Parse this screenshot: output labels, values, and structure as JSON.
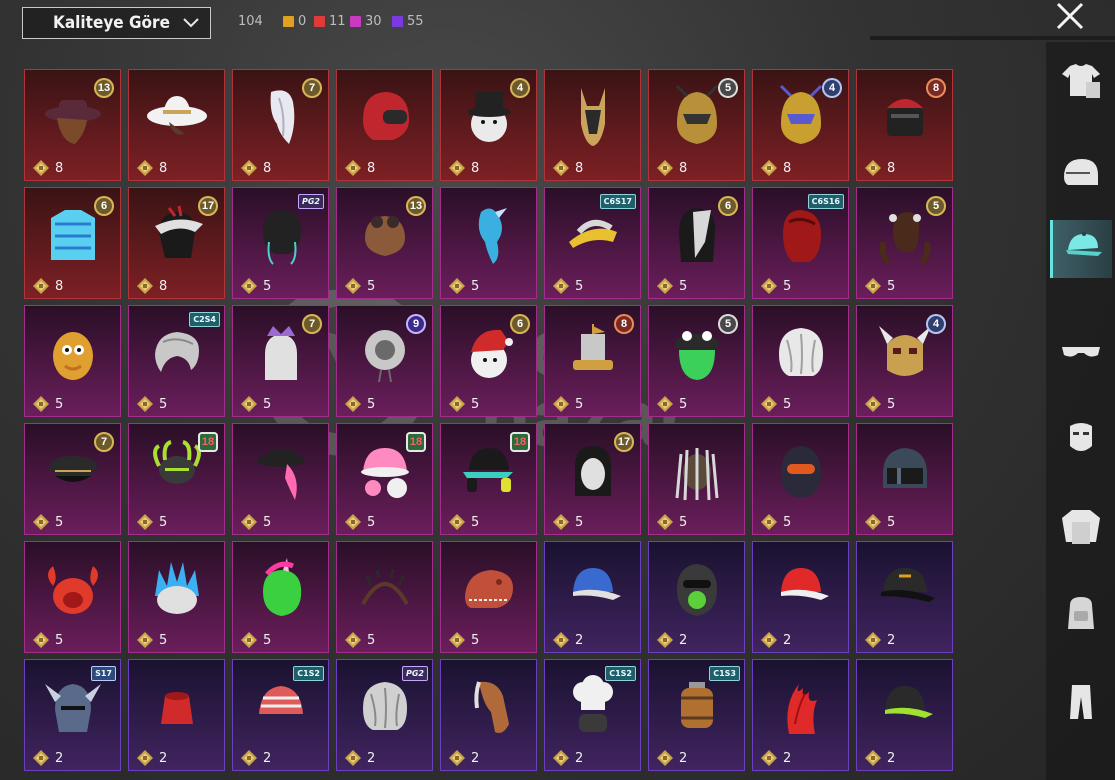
{
  "toolbar": {
    "sort_label": "Kaliteye Göre",
    "total_count": "104",
    "stats": [
      {
        "color": "#e0a020",
        "value": "0"
      },
      {
        "color": "#e03a3a",
        "value": "11"
      },
      {
        "color": "#c83ac0",
        "value": "30"
      },
      {
        "color": "#7a3ae0",
        "value": "55"
      }
    ]
  },
  "watermark": {
    "brand_top": "item",
    "brand_bottom": "pazar",
    "suffix": ".com"
  },
  "items": [
    {
      "tier": "red",
      "qty": "8",
      "badge": "13",
      "badge_style": "gold",
      "icon": "hat-wide-brim",
      "colors": [
        "#5a2a3a",
        "#d8b8a0"
      ]
    },
    {
      "tier": "red",
      "qty": "8",
      "badge": "",
      "badge_style": "",
      "icon": "cowboy-hat",
      "colors": [
        "#f2f2f2",
        "#c9a45a"
      ]
    },
    {
      "tier": "red",
      "qty": "8",
      "badge": "7",
      "badge_style": "gold",
      "icon": "hair-white",
      "colors": [
        "#e8e8f0",
        "#b0b0c0"
      ]
    },
    {
      "tier": "red",
      "qty": "8",
      "badge": "",
      "badge_style": "",
      "icon": "helmet-red",
      "colors": [
        "#c0262e",
        "#2a2a2a"
      ]
    },
    {
      "tier": "red",
      "qty": "8",
      "badge": "4",
      "badge_style": "gold",
      "icon": "snowman-head",
      "colors": [
        "#eaeaea",
        "#222"
      ]
    },
    {
      "tier": "red",
      "qty": "8",
      "badge": "",
      "badge_style": "",
      "icon": "anubis-mask",
      "colors": [
        "#c9a45a",
        "#2a2a2a"
      ]
    },
    {
      "tier": "red",
      "qty": "8",
      "badge": "5",
      "badge_style": "gray",
      "icon": "gold-helmet",
      "colors": [
        "#b8903a",
        "#333"
      ]
    },
    {
      "tier": "red",
      "qty": "8",
      "badge": "4",
      "badge_style": "blue",
      "icon": "gold-helmet",
      "colors": [
        "#c9a030",
        "#5a5ad0"
      ]
    },
    {
      "tier": "red",
      "qty": "8",
      "badge": "8",
      "badge_style": "red",
      "icon": "samurai-helmet",
      "colors": [
        "#c0262e",
        "#222"
      ]
    },
    {
      "tier": "red",
      "qty": "8",
      "badge": "6",
      "badge_style": "gold",
      "icon": "ice-vest",
      "colors": [
        "#5ad0f0",
        "#2a7ad0"
      ]
    },
    {
      "tier": "red",
      "qty": "8",
      "badge": "17",
      "badge_style": "gold",
      "icon": "mask-dark",
      "colors": [
        "#e0e0e0",
        "#c0262e"
      ]
    },
    {
      "tier": "mag",
      "qty": "5",
      "badge": "PG2",
      "badge_style": "tag-pink",
      "icon": "hair-dark",
      "colors": [
        "#222",
        "#4ad0d0"
      ]
    },
    {
      "tier": "mag",
      "qty": "5",
      "badge": "13",
      "badge_style": "gold",
      "icon": "pilot-cap",
      "colors": [
        "#8a5a3a",
        "#3a2a2a"
      ]
    },
    {
      "tier": "mag",
      "qty": "5",
      "badge": "",
      "badge_style": "",
      "icon": "bird-hat",
      "colors": [
        "#3ab0e0",
        "#c8e0ff"
      ]
    },
    {
      "tier": "mag",
      "qty": "5",
      "badge": "C6S17",
      "badge_style": "tag",
      "icon": "visor",
      "colors": [
        "#e8c030",
        "#d8d8d8"
      ]
    },
    {
      "tier": "mag",
      "qty": "5",
      "badge": "6",
      "badge_style": "gold",
      "icon": "hood-mask",
      "colors": [
        "#d8d8d8",
        "#222"
      ]
    },
    {
      "tier": "mag",
      "qty": "5",
      "badge": "C6S16",
      "badge_style": "tag",
      "icon": "hair-red",
      "colors": [
        "#a01818",
        "#5a0a0a"
      ]
    },
    {
      "tier": "mag",
      "qty": "5",
      "badge": "5",
      "badge_style": "gold",
      "icon": "hair-pigtails",
      "colors": [
        "#4a2a1a",
        "#e0e0e0"
      ]
    },
    {
      "tier": "mag",
      "qty": "5",
      "badge": "",
      "badge_style": "",
      "icon": "potato-head",
      "colors": [
        "#e0a030",
        "#c07020"
      ]
    },
    {
      "tier": "mag",
      "qty": "5",
      "badge": "C2S4",
      "badge_style": "tag",
      "icon": "hair-gray",
      "colors": [
        "#c8c8c8",
        "#8a8a8a"
      ]
    },
    {
      "tier": "mag",
      "qty": "5",
      "badge": "7",
      "badge_style": "gold",
      "icon": "crown-hood",
      "colors": [
        "#e0e0e0",
        "#9a6ad0"
      ]
    },
    {
      "tier": "mag",
      "qty": "5",
      "badge": "9",
      "badge_style": "violet",
      "icon": "diving-helmet",
      "colors": [
        "#c8c8c8",
        "#6a6a6a"
      ]
    },
    {
      "tier": "mag",
      "qty": "5",
      "badge": "6",
      "badge_style": "gold",
      "icon": "santa-head",
      "colors": [
        "#d02a2a",
        "#f0f0f0"
      ]
    },
    {
      "tier": "mag",
      "qty": "5",
      "badge": "8",
      "badge_style": "red",
      "icon": "ship-hat",
      "colors": [
        "#d0a040",
        "#c8c8c8"
      ]
    },
    {
      "tier": "mag",
      "qty": "5",
      "badge": "5",
      "badge_style": "gray",
      "icon": "frog-hat",
      "colors": [
        "#3ad05a",
        "#2a2a2a"
      ]
    },
    {
      "tier": "mag",
      "qty": "5",
      "badge": "",
      "badge_style": "",
      "icon": "hair-silver",
      "colors": [
        "#e8e8e8",
        "#a0a0a0"
      ]
    },
    {
      "tier": "mag",
      "qty": "5",
      "badge": "4",
      "badge_style": "blue",
      "icon": "oni-mask",
      "colors": [
        "#c8a050",
        "#5a1a1a"
      ]
    },
    {
      "tier": "mag",
      "qty": "5",
      "badge": "7",
      "badge_style": "gold",
      "icon": "officer-cap",
      "colors": [
        "#2a2a2a",
        "#c9a45a"
      ]
    },
    {
      "tier": "mag",
      "qty": "5",
      "badge": "18",
      "badge_style": "green",
      "icon": "alien-hat",
      "colors": [
        "#a8e030",
        "#3a3a3a"
      ]
    },
    {
      "tier": "mag",
      "qty": "5",
      "badge": "",
      "badge_style": "",
      "icon": "pink-hair-hat",
      "colors": [
        "#ff6ab0",
        "#222"
      ]
    },
    {
      "tier": "mag",
      "qty": "5",
      "badge": "18",
      "badge_style": "green",
      "icon": "pink-hat",
      "colors": [
        "#ff8ac0",
        "#f0f0f0"
      ]
    },
    {
      "tier": "mag",
      "qty": "5",
      "badge": "18",
      "badge_style": "green",
      "icon": "headphones-cap",
      "colors": [
        "#1a1a1a",
        "#e0e030"
      ]
    },
    {
      "tier": "mag",
      "qty": "5",
      "badge": "17",
      "badge_style": "gold",
      "icon": "mask-white",
      "colors": [
        "#e0e0e0",
        "#1a1a1a"
      ]
    },
    {
      "tier": "mag",
      "qty": "5",
      "badge": "",
      "badge_style": "",
      "icon": "dreadlocks",
      "colors": [
        "#d8d8d8",
        "#3a3a3a"
      ]
    },
    {
      "tier": "mag",
      "qty": "5",
      "badge": "",
      "badge_style": "",
      "icon": "space-helmet",
      "colors": [
        "#2a2a3a",
        "#e05a20"
      ]
    },
    {
      "tier": "mag",
      "qty": "5",
      "badge": "",
      "badge_style": "",
      "icon": "riot-helmet",
      "colors": [
        "#3a4a5a",
        "#1a1a1a"
      ]
    },
    {
      "tier": "mag",
      "qty": "5",
      "badge": "",
      "badge_style": "",
      "icon": "crab-hat",
      "colors": [
        "#e03a2a",
        "#a01818"
      ]
    },
    {
      "tier": "mag",
      "qty": "5",
      "badge": "",
      "badge_style": "",
      "icon": "spiky-hat",
      "colors": [
        "#3ab0f0",
        "#e0e0e0"
      ]
    },
    {
      "tier": "mag",
      "qty": "5",
      "badge": "",
      "badge_style": "",
      "icon": "unicorn-head",
      "colors": [
        "#3ad040",
        "#ff3aa0"
      ]
    },
    {
      "tier": "mag",
      "qty": "5",
      "badge": "",
      "badge_style": "",
      "icon": "headband",
      "colors": [
        "#5a3a2a",
        "#2a2a2a"
      ]
    },
    {
      "tier": "mag",
      "qty": "5",
      "badge": "",
      "badge_style": "",
      "icon": "dino-head",
      "colors": [
        "#c0503a",
        "#7a2a1a"
      ]
    },
    {
      "tier": "pur",
      "qty": "2",
      "badge": "",
      "badge_style": "",
      "icon": "baseball-cap",
      "colors": [
        "#3a6ad0",
        "#e0e0e0"
      ]
    },
    {
      "tier": "pur",
      "qty": "2",
      "badge": "",
      "badge_style": "",
      "icon": "gas-helmet",
      "colors": [
        "#3a3a3a",
        "#5ad03a"
      ]
    },
    {
      "tier": "pur",
      "qty": "2",
      "badge": "",
      "badge_style": "",
      "icon": "baseball-cap",
      "colors": [
        "#e02a2a",
        "#f0f0f0"
      ]
    },
    {
      "tier": "pur",
      "qty": "2",
      "badge": "",
      "badge_style": "",
      "icon": "snapback",
      "colors": [
        "#2a2a2a",
        "#e0a020"
      ]
    },
    {
      "tier": "pur",
      "qty": "2",
      "badge": "S17",
      "badge_style": "tag-steel",
      "icon": "knight-helmet",
      "colors": [
        "#5a6a8a",
        "#c8d0e0"
      ]
    },
    {
      "tier": "pur",
      "qty": "2",
      "badge": "",
      "badge_style": "",
      "icon": "fez",
      "colors": [
        "#d02a2a",
        "#a01818"
      ]
    },
    {
      "tier": "pur",
      "qty": "2",
      "badge": "C1S2",
      "badge_style": "tag",
      "icon": "bandana",
      "colors": [
        "#e05a5a",
        "#f0f0f0"
      ]
    },
    {
      "tier": "pur",
      "qty": "2",
      "badge": "PG2",
      "badge_style": "tag-pink",
      "icon": "hair-silver",
      "colors": [
        "#d0d0d0",
        "#8a8a8a"
      ]
    },
    {
      "tier": "pur",
      "qty": "2",
      "badge": "",
      "badge_style": "",
      "icon": "horse-head",
      "colors": [
        "#b06a3a",
        "#e0e0e0"
      ]
    },
    {
      "tier": "pur",
      "qty": "2",
      "badge": "C1S2",
      "badge_style": "tag",
      "icon": "chef-hat",
      "colors": [
        "#f0f0f0",
        "#3a3a3a"
      ]
    },
    {
      "tier": "pur",
      "qty": "2",
      "badge": "C1S3",
      "badge_style": "tag",
      "icon": "barrel-hat",
      "colors": [
        "#b07030",
        "#5a3a20"
      ]
    },
    {
      "tier": "pur",
      "qty": "2",
      "badge": "",
      "badge_style": "",
      "icon": "mohawk",
      "colors": [
        "#e02a2a",
        "#a01010"
      ]
    },
    {
      "tier": "pur",
      "qty": "2",
      "badge": "",
      "badge_style": "",
      "icon": "baseball-cap",
      "colors": [
        "#2a2a2a",
        "#a0e030"
      ]
    }
  ],
  "sidebar": [
    {
      "name": "outfit",
      "active": false
    },
    {
      "name": "helmet",
      "active": false
    },
    {
      "name": "cap",
      "active": true
    },
    {
      "name": "glasses",
      "active": false
    },
    {
      "name": "mask",
      "active": false
    },
    {
      "name": "jacket",
      "active": false
    },
    {
      "name": "backpack",
      "active": false
    },
    {
      "name": "pants",
      "active": false
    }
  ]
}
